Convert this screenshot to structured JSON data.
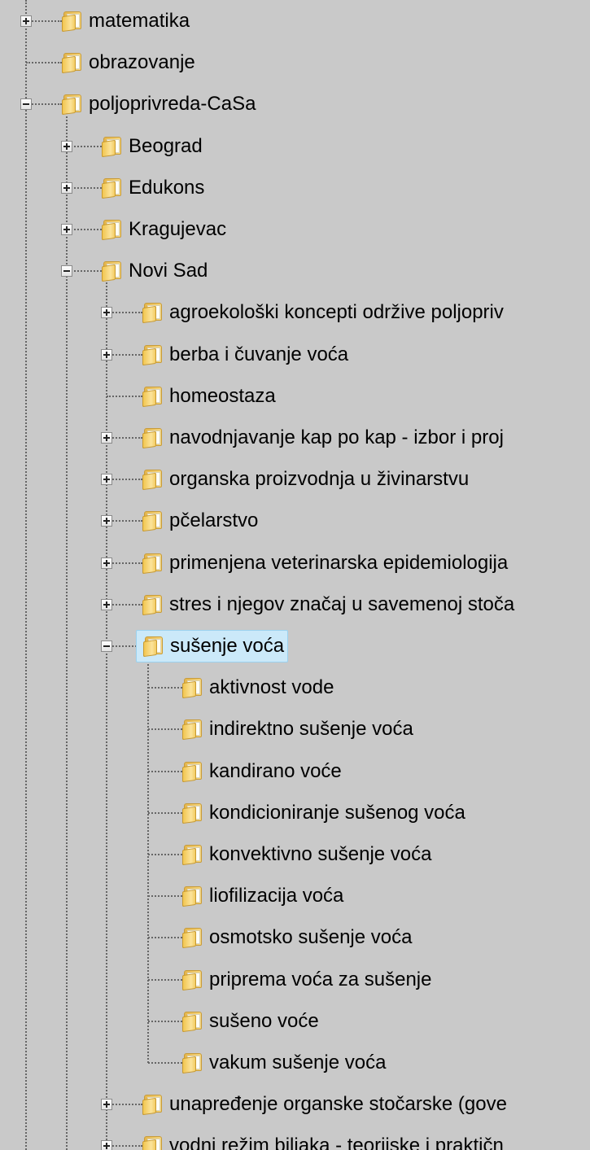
{
  "tree": {
    "nodes": [
      {
        "label": "matematika",
        "toggle": "plus"
      },
      {
        "label": "obrazovanje",
        "toggle": "none"
      },
      {
        "label": "poljoprivreda-CaSa",
        "toggle": "minus",
        "expanded": true
      },
      {
        "label": "Beograd",
        "toggle": "plus"
      },
      {
        "label": "Edukons",
        "toggle": "plus"
      },
      {
        "label": "Kragujevac",
        "toggle": "plus"
      },
      {
        "label": "Novi Sad",
        "toggle": "minus",
        "expanded": true
      },
      {
        "label": "agroekološki koncepti održive poljopriv",
        "toggle": "plus"
      },
      {
        "label": "berba i čuvanje voća",
        "toggle": "plus"
      },
      {
        "label": "homeostaza",
        "toggle": "none"
      },
      {
        "label": "navodnjavanje kap po kap - izbor i proj",
        "toggle": "plus"
      },
      {
        "label": "organska proizvodnja u živinarstvu",
        "toggle": "plus"
      },
      {
        "label": "pčelarstvo",
        "toggle": "plus"
      },
      {
        "label": "primenjena veterinarska epidemiologija",
        "toggle": "plus"
      },
      {
        "label": "stres i njegov značaj u savemenoj stoča",
        "toggle": "plus"
      },
      {
        "label": "sušenje voća",
        "toggle": "minus",
        "expanded": true,
        "selected": true
      },
      {
        "label": "aktivnost vode",
        "toggle": "none"
      },
      {
        "label": "indirektno sušenje voća",
        "toggle": "none"
      },
      {
        "label": "kandirano voće",
        "toggle": "none"
      },
      {
        "label": "kondicioniranje sušenog voća",
        "toggle": "none"
      },
      {
        "label": "konvektivno sušenje voća",
        "toggle": "none"
      },
      {
        "label": "liofilizacija voća",
        "toggle": "none"
      },
      {
        "label": "osmotsko sušenje voća",
        "toggle": "none"
      },
      {
        "label": "priprema voća za sušenje",
        "toggle": "none"
      },
      {
        "label": "sušeno voće",
        "toggle": "none"
      },
      {
        "label": "vakum sušenje voća",
        "toggle": "none"
      },
      {
        "label": "unapređenje organske stočarske (gove",
        "toggle": "plus"
      },
      {
        "label": "vodni režim biljaka - teorijske i praktičn",
        "toggle": "plus"
      }
    ]
  },
  "colors": {
    "background": "#c9c9c9",
    "selection_fill": "#cbe9f9",
    "selection_border": "#9bd1ee",
    "folder": "#f2c650"
  },
  "icons": {
    "folder": "folder-icon",
    "expand": "expand-plus-icon",
    "collapse": "collapse-minus-icon"
  }
}
